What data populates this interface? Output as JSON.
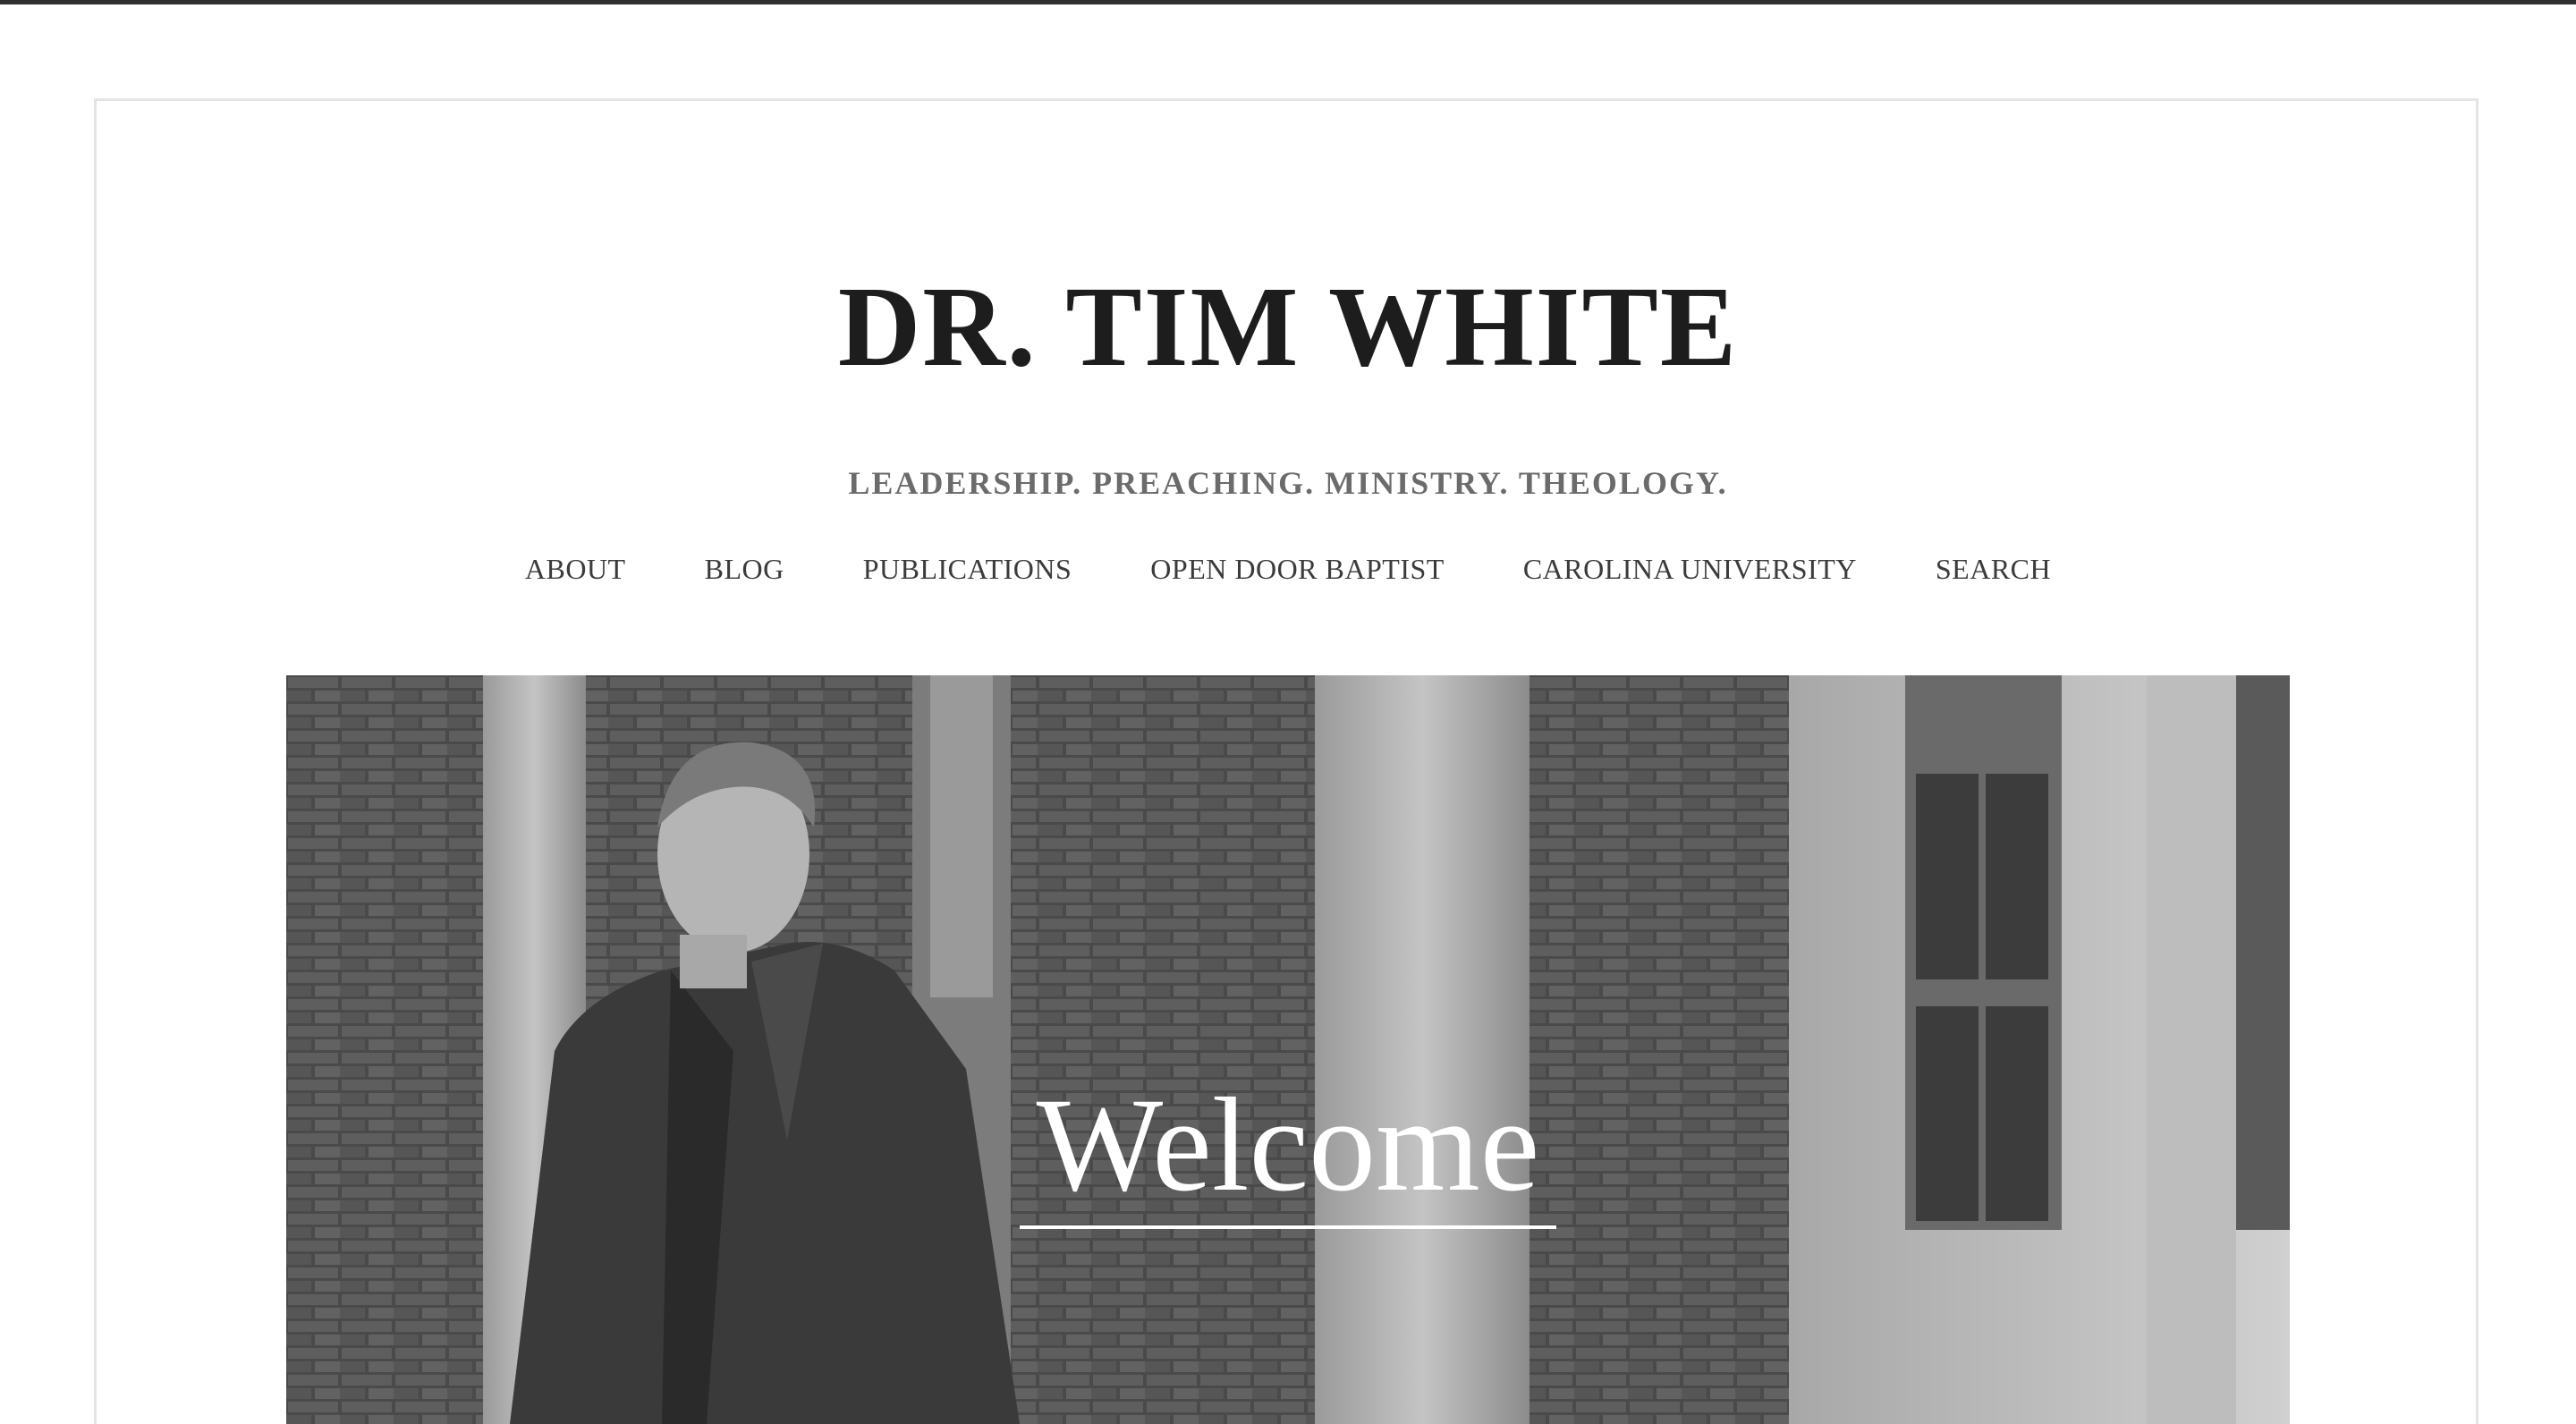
{
  "site": {
    "title": "DR. TIM WHITE",
    "tagline": "LEADERSHIP. PREACHING. MINISTRY. THEOLOGY."
  },
  "nav": {
    "items": [
      {
        "label": "ABOUT"
      },
      {
        "label": "BLOG"
      },
      {
        "label": "PUBLICATIONS"
      },
      {
        "label": "OPEN DOOR BAPTIST"
      },
      {
        "label": "CAROLINA UNIVERSITY"
      },
      {
        "label": "SEARCH"
      }
    ]
  },
  "hero": {
    "heading": "Welcome"
  },
  "colors": {
    "title": "#1d1d1d",
    "tagline": "#6b6b6b",
    "nav": "#3b3b3b",
    "frame_border": "#e4e4e4",
    "top_bar": "#2f2f2f"
  }
}
